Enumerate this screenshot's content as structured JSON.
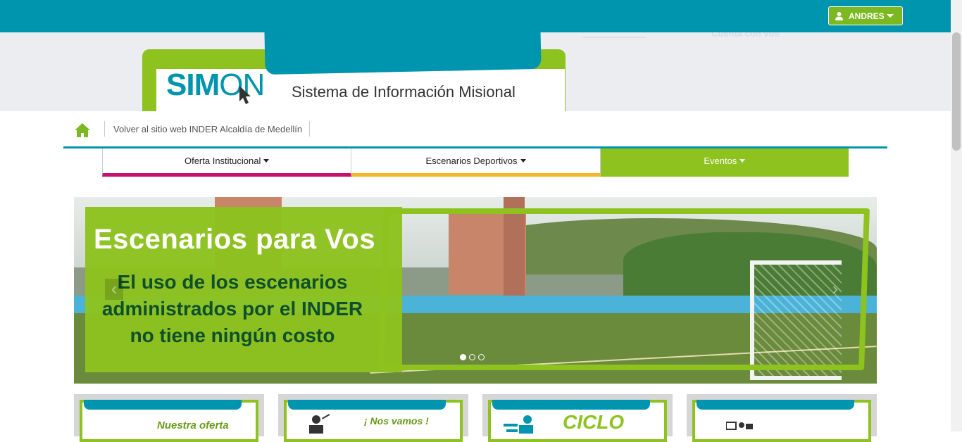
{
  "topbar": {
    "user_label": "ANDRES",
    "brand_color": "#0095ae",
    "accent_color": "#8dc21f",
    "faint_text": "Cuenta con vos"
  },
  "logo": {
    "sim": "SIM",
    "on": "ON",
    "subtitle": "Sistema de Información Misional"
  },
  "breadcrumb": {
    "home_icon": "home-icon",
    "back_link": "Volver al sitio web INDER Alcaldía de Medellín"
  },
  "nav": {
    "items": [
      {
        "label": "Oferta Institucional",
        "color": "#c5126e"
      },
      {
        "label": "Escenarios Deportivos",
        "color": "#f3b52a"
      },
      {
        "label": "Eventos",
        "color": "#8dc21f"
      }
    ]
  },
  "slider": {
    "title": "Escenarios para Vos",
    "text": "El uso de los escenarios administrados por el INDER no tiene ningún costo",
    "slides_total": 3,
    "active_slide": 1,
    "prev_icon": "chevron-left-icon",
    "next_icon": "chevron-right-icon"
  },
  "cards": [
    {
      "text": "Nuestra oferta"
    },
    {
      "text": "¡ Nos vamos !"
    },
    {
      "text": "CICLO"
    },
    {
      "text": ""
    }
  ]
}
